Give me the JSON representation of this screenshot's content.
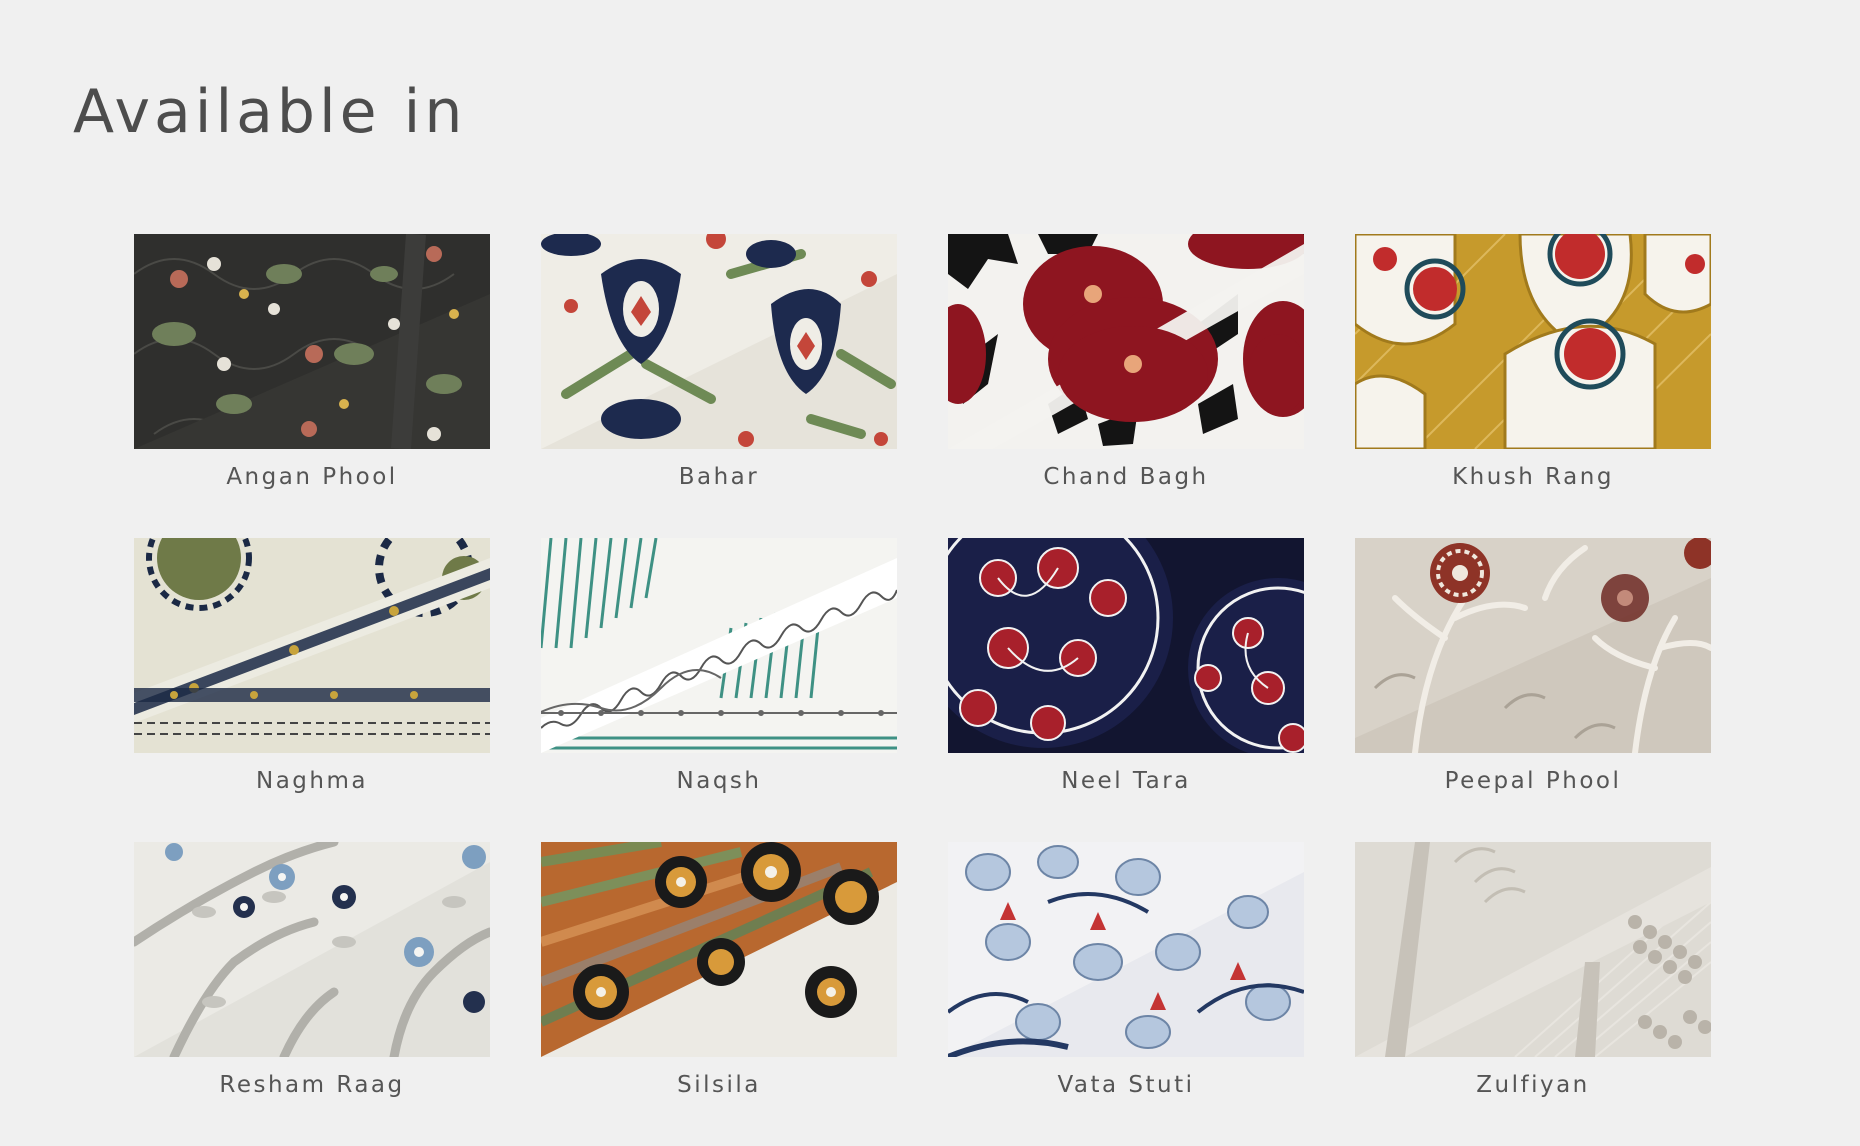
{
  "heading": "Available in",
  "patterns": [
    {
      "name": "Angan Phool",
      "icon": "angan-phool-swatch"
    },
    {
      "name": "Bahar",
      "icon": "bahar-swatch"
    },
    {
      "name": "Chand Bagh",
      "icon": "chand-bagh-swatch"
    },
    {
      "name": "Khush Rang",
      "icon": "khush-rang-swatch"
    },
    {
      "name": "Naghma",
      "icon": "naghma-swatch"
    },
    {
      "name": "Naqsh",
      "icon": "naqsh-swatch"
    },
    {
      "name": "Neel Tara",
      "icon": "neel-tara-swatch"
    },
    {
      "name": "Peepal Phool",
      "icon": "peepal-phool-swatch"
    },
    {
      "name": "Resham Raag",
      "icon": "resham-raag-swatch"
    },
    {
      "name": "Silsila",
      "icon": "silsila-swatch"
    },
    {
      "name": "Vata Stuti",
      "icon": "vata-stuti-swatch"
    },
    {
      "name": "Zulfiyan",
      "icon": "zulfiyan-swatch"
    }
  ],
  "colors": {
    "background": "#f0f0f0",
    "heading": "#4d4d4d",
    "label": "#555555"
  }
}
